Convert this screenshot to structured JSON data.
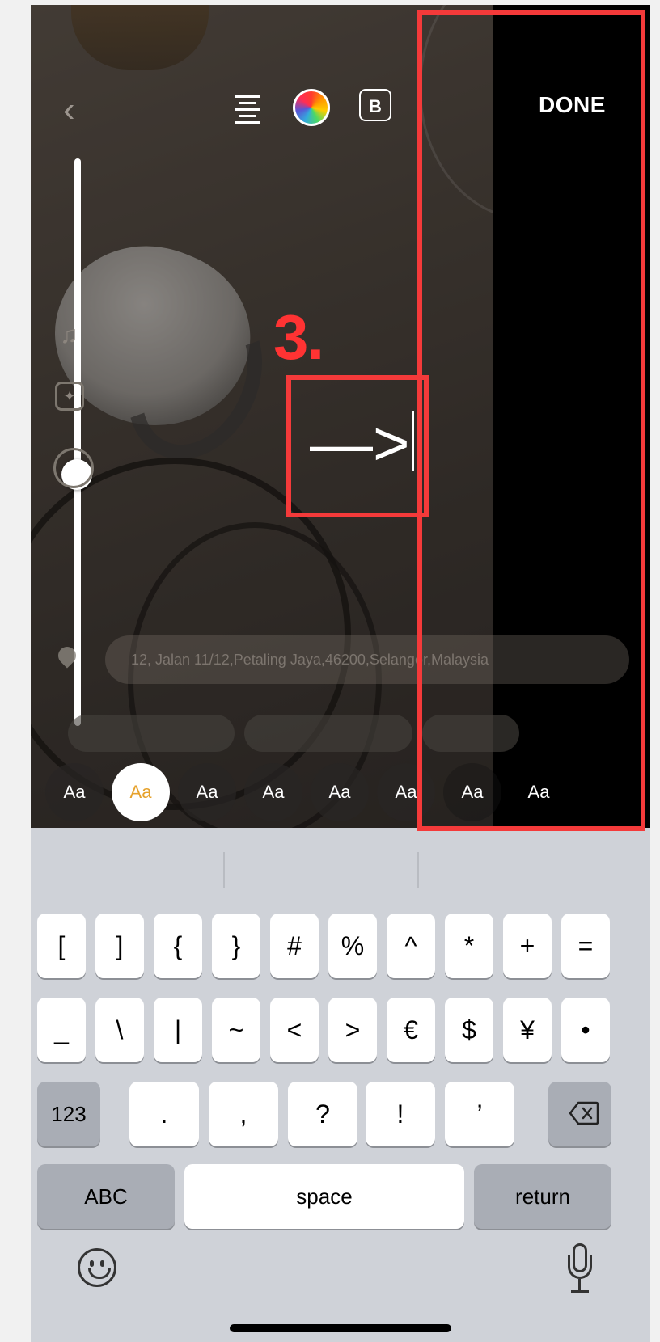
{
  "toolbar": {
    "back_label": "‹",
    "align_icon": "align-center-icon",
    "color_icon": "color-wheel-icon",
    "bold_label": "B",
    "done_label": "DONE"
  },
  "text_editor": {
    "typed_text": "—>",
    "font_size_level": 0.53
  },
  "annotation": {
    "step_label": "3.",
    "highlight_color": "#f43a3a"
  },
  "location": {
    "text": "12, Jalan 11/12,Petaling Jaya,46200,Selangor,Malaysia"
  },
  "font_styles": {
    "labels": [
      "Aa",
      "Aa",
      "Aa",
      "Aa",
      "Aa",
      "Aa",
      "Aa",
      "Aa"
    ],
    "selected_index": 1,
    "selected_color": "#e6a12b"
  },
  "keyboard": {
    "row1": [
      "[",
      "]",
      "{",
      "}",
      "#",
      "%",
      "^",
      "*",
      "+",
      "="
    ],
    "row2": [
      "_",
      "\\",
      "|",
      "~",
      "<",
      ">",
      "€",
      "$",
      "¥",
      "•"
    ],
    "row3": {
      "mode_label": "123",
      "keys": [
        ".",
        ",",
        "?",
        "!",
        "’"
      ]
    },
    "row4": {
      "abc_label": "ABC",
      "space_label": "space",
      "return_label": "return"
    }
  }
}
